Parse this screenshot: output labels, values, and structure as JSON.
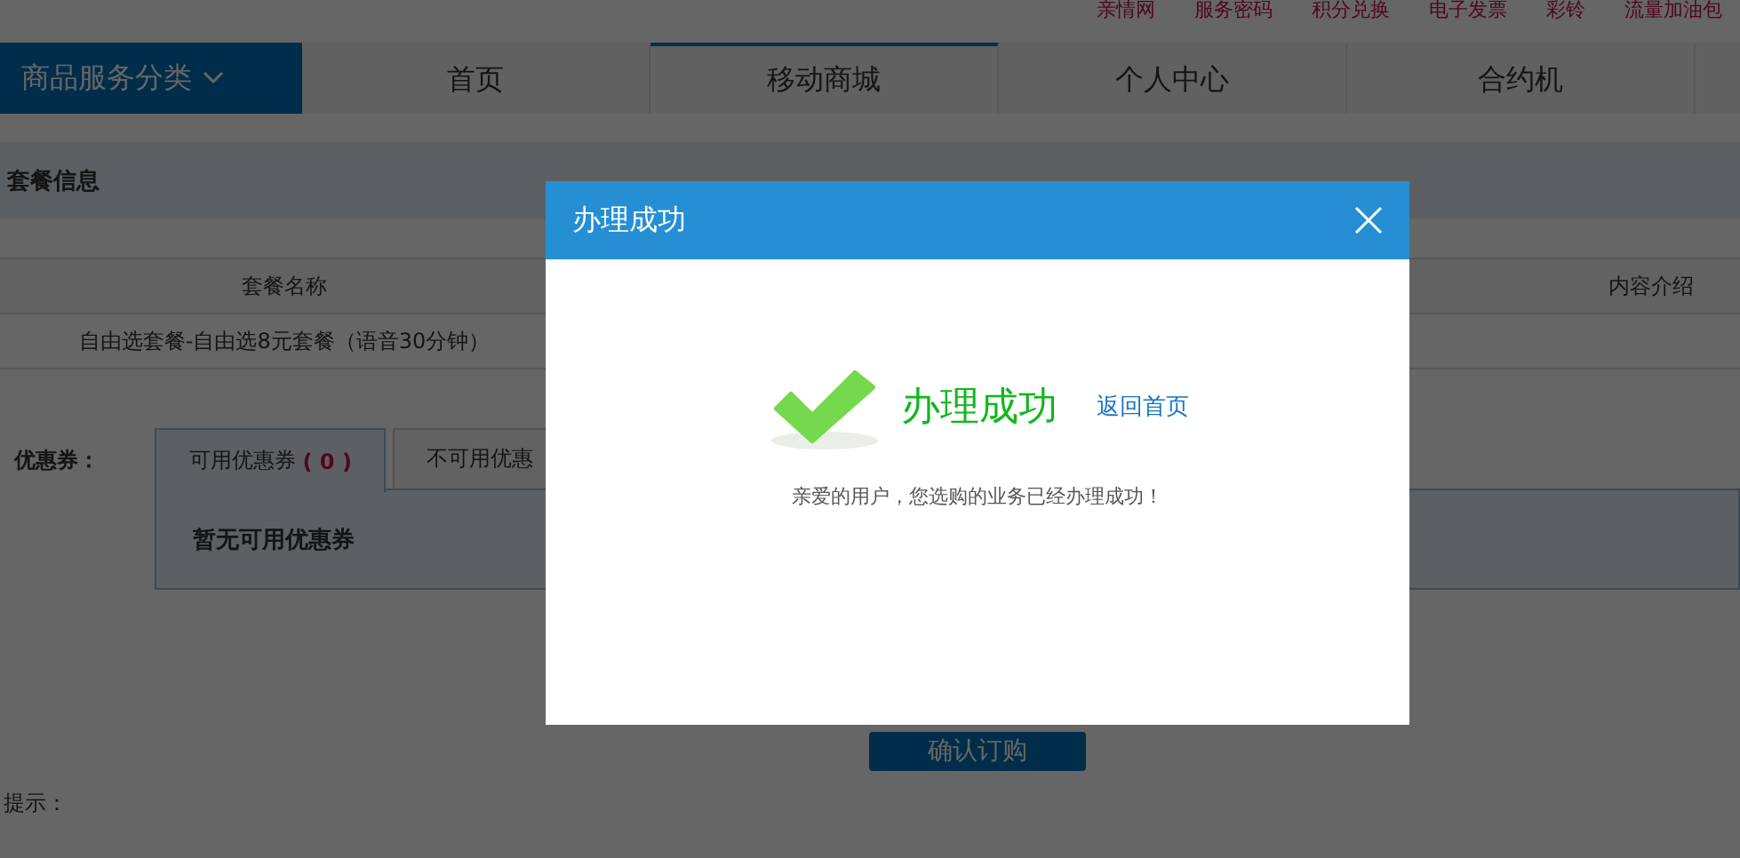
{
  "top_links": [
    "亲情网",
    "服务密码",
    "积分兑换",
    "电子发票",
    "彩铃",
    "流量加油包"
  ],
  "nav": {
    "category": "商品服务分类",
    "items": [
      {
        "label": "首页",
        "selected": false
      },
      {
        "label": "移动商城",
        "selected": true
      },
      {
        "label": "个人中心",
        "selected": false
      },
      {
        "label": "合约机",
        "selected": false
      }
    ]
  },
  "section_title": "套餐信息",
  "table": {
    "columns": [
      "套餐名称",
      "内容介绍"
    ],
    "rows": [
      {
        "name": "自由选套餐-自由选8元套餐（语音30分钟）"
      }
    ]
  },
  "coupons": {
    "label": "优惠券：",
    "tabs": [
      {
        "label": "可用优惠券",
        "count": "( 0 )",
        "selected": true
      },
      {
        "label": "不可用优惠",
        "selected": false
      }
    ],
    "empty_text": "暂无可用优惠券"
  },
  "order_button": "确认订购",
  "tips_label": "提示：",
  "dialog": {
    "title": "办理成功",
    "status": "办理成功",
    "link": "返回首页",
    "message": "亲爱的用户，您选购的业务已经办理成功！"
  }
}
